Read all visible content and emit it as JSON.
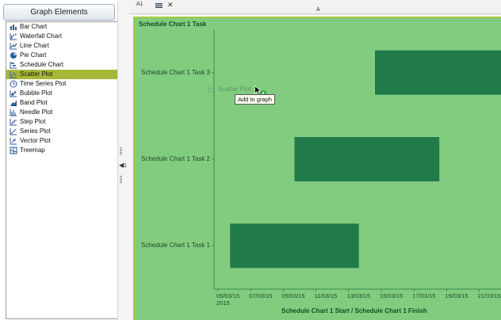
{
  "panel": {
    "title": "Graph Elements",
    "items": [
      {
        "label": "Bar Chart",
        "icon": "bar-chart-icon",
        "selected": false
      },
      {
        "label": "Waterfall Chart",
        "icon": "waterfall-chart-icon",
        "selected": false
      },
      {
        "label": "Line Chart",
        "icon": "line-chart-icon",
        "selected": false
      },
      {
        "label": "Pie Chart",
        "icon": "pie-chart-icon",
        "selected": false
      },
      {
        "label": "Schedule Chart",
        "icon": "schedule-chart-icon",
        "selected": false
      },
      {
        "label": "Scatter Plot",
        "icon": "scatter-plot-icon",
        "selected": true
      },
      {
        "label": "Time Series Plot",
        "icon": "time-series-plot-icon",
        "selected": false
      },
      {
        "label": "Bubble Plot",
        "icon": "bubble-plot-icon",
        "selected": false
      },
      {
        "label": "Band Plot",
        "icon": "band-plot-icon",
        "selected": false
      },
      {
        "label": "Needle Plot",
        "icon": "needle-plot-icon",
        "selected": false
      },
      {
        "label": "Step Plot",
        "icon": "step-plot-icon",
        "selected": false
      },
      {
        "label": "Series Plot",
        "icon": "series-plot-icon",
        "selected": false
      },
      {
        "label": "Vector Plot",
        "icon": "vector-plot-icon",
        "selected": false
      },
      {
        "label": "Treemap",
        "icon": "treemap-icon",
        "selected": false
      }
    ],
    "collapse_index": "1"
  },
  "toolbar": {
    "cell_ref": "A1",
    "column_header": "A"
  },
  "graph": {
    "title": "Schedule Chart 1 Task",
    "x_axis_title": "Schedule Chart 1 Start / Schedule Chart 1 Finish",
    "year_label": "2015"
  },
  "drag": {
    "ghost_label": "Scatter Plot",
    "tooltip": "Add to graph"
  },
  "colors": {
    "plot_background": "#82cc80",
    "task_bar": "#217a4a",
    "selection": "#a7b839",
    "frame_border": "#a6c83a"
  },
  "chart_data": {
    "type": "bar",
    "orientation": "horizontal-gantt",
    "categories": [
      "Schedule Chart 1 Task 1",
      "Schedule Chart 1 Task 2",
      "Schedule Chart 1 Task 3"
    ],
    "tasks": [
      {
        "name": "Schedule Chart 1 Task 1",
        "start": "2015-03-05",
        "finish": "2015-03-13"
      },
      {
        "name": "Schedule Chart 1 Task 2",
        "start": "2015-03-09",
        "finish": "2015-03-18"
      },
      {
        "name": "Schedule Chart 1 Task 3",
        "start": "2015-03-14",
        "finish": "2015-03-22"
      }
    ],
    "x_ticks": [
      "05/03/15",
      "07/03/15",
      "09/03/15",
      "11/03/15",
      "13/03/15",
      "15/03/15",
      "17/03/15",
      "19/03/15",
      "21/03/15"
    ],
    "title": "Schedule Chart 1 Task",
    "xlabel": "Schedule Chart 1 Start / Schedule Chart 1 Finish",
    "ylabel": "",
    "grid": false
  }
}
